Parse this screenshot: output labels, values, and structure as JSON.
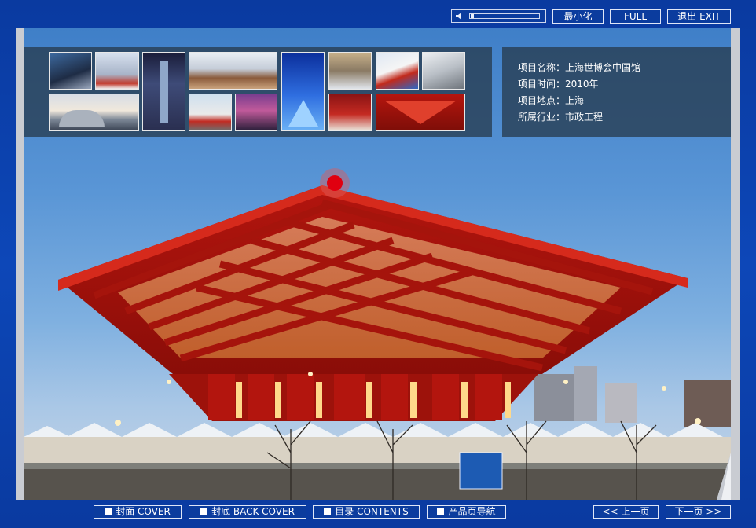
{
  "toolbar": {
    "volume_level": 0.05,
    "minimize_label": "最小化",
    "full_label": "FULL",
    "exit_label": "退出 EXIT"
  },
  "info_panel": {
    "name": "项目名称：上海世博会中国馆",
    "time": "项目时间：2010年",
    "location": "项目地点：上海",
    "industry": "所属行业：市政工程"
  },
  "thumbnails": [
    "stadium-night",
    "office-building",
    "tower-skyscraper",
    "birds-nest",
    "blue-glass-building",
    "glass-building-evening",
    "logo-building",
    "white-curved-building",
    "opera-house-dusk",
    "red-flag-square",
    "city-skyline",
    "water-cube",
    "red-white-building",
    "china-pavilion"
  ],
  "nav": {
    "cover": "封面 COVER",
    "back_cover": "封底 BACK COVER",
    "contents": "目录 CONTENTS",
    "product_nav": "产品页导航",
    "prev": "<< 上一页",
    "next": "下一页 >>"
  },
  "colors": {
    "frame": "#0b3c9e",
    "pavilion_red": "#c21a12",
    "hotspot": "#e00010"
  }
}
